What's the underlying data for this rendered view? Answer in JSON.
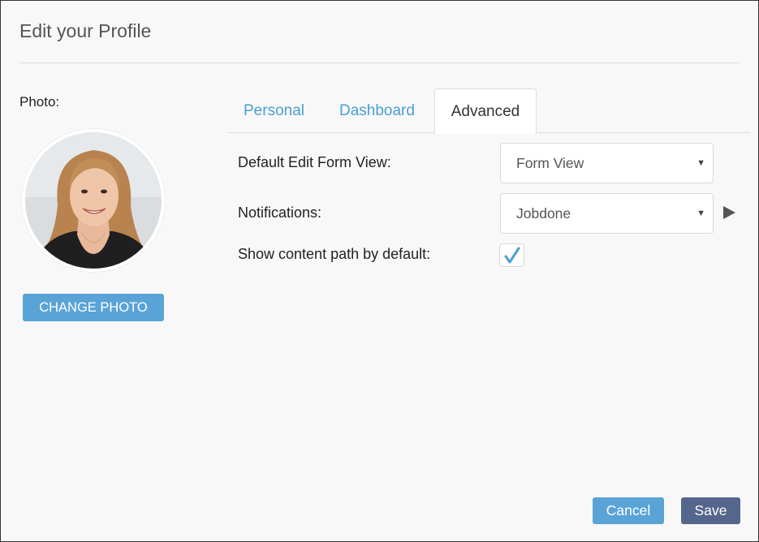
{
  "dialog": {
    "title": "Edit your Profile"
  },
  "photo": {
    "label": "Photo:",
    "change_button": "CHANGE PHOTO"
  },
  "tabs": [
    {
      "label": "Personal",
      "active": false
    },
    {
      "label": "Dashboard",
      "active": false
    },
    {
      "label": "Advanced",
      "active": true
    }
  ],
  "advanced": {
    "default_view_label": "Default Edit Form View:",
    "default_view_value": "Form View",
    "notifications_label": "Notifications:",
    "notifications_value": "Jobdone",
    "content_path_label": "Show content path by default:",
    "content_path_checked": true
  },
  "footer": {
    "cancel_label": "Cancel",
    "save_label": "Save"
  },
  "colors": {
    "accent": "#5aa3d6",
    "save": "#54668c",
    "tab_link": "#4a9fd1"
  }
}
